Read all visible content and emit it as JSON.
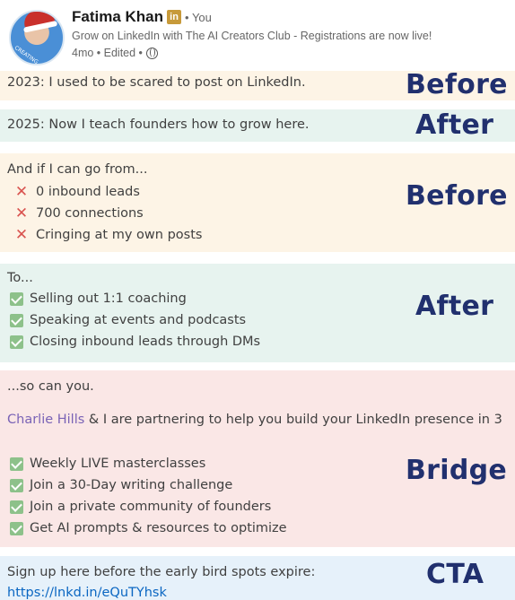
{
  "header": {
    "name": "Fatima Khan",
    "linkedin_badge": "in",
    "you_label": "• You",
    "headline": "Grow on LinkedIn with The AI Creators Club - Registrations are now live!",
    "meta": "4mo • Edited •",
    "avatar_text": "CREATING"
  },
  "sections": {
    "before1": {
      "tag": "Before",
      "text": "2023: I used to be scared to post on LinkedIn."
    },
    "after1": {
      "tag": "After",
      "text": "2025: Now I teach founders how to grow here."
    },
    "before2": {
      "tag": "Before",
      "intro": "And if I can go from...",
      "items": [
        "0 inbound leads",
        "700 connections",
        "Cringing at my own posts"
      ]
    },
    "after2": {
      "tag": "After",
      "intro": "To...",
      "items": [
        "Selling out 1:1 coaching",
        "Speaking at events and podcasts",
        "Closing inbound leads through DMs"
      ]
    },
    "bridge": {
      "tag": "Bridge",
      "line1": "...so can you.",
      "mention": "Charlie Hills",
      "line2_rest": " & I are partnering to help you build your LinkedIn presence in 3",
      "items": [
        "Weekly LIVE masterclasses",
        "Join a 30-Day writing challenge",
        "Join a private community of founders",
        "Get AI prompts & resources to optimize"
      ]
    },
    "cta": {
      "tag": "CTA",
      "text": "Sign up here before the early bird spots expire:",
      "link": "https://lnkd.in/eQuTYhsk"
    }
  },
  "colors": {
    "before_bg": "#fdf4e6",
    "after_bg": "#e7f3ef",
    "bridge_bg": "#fae7e6",
    "cta_bg": "#e6f1fa",
    "tag_color": "#21306e"
  }
}
